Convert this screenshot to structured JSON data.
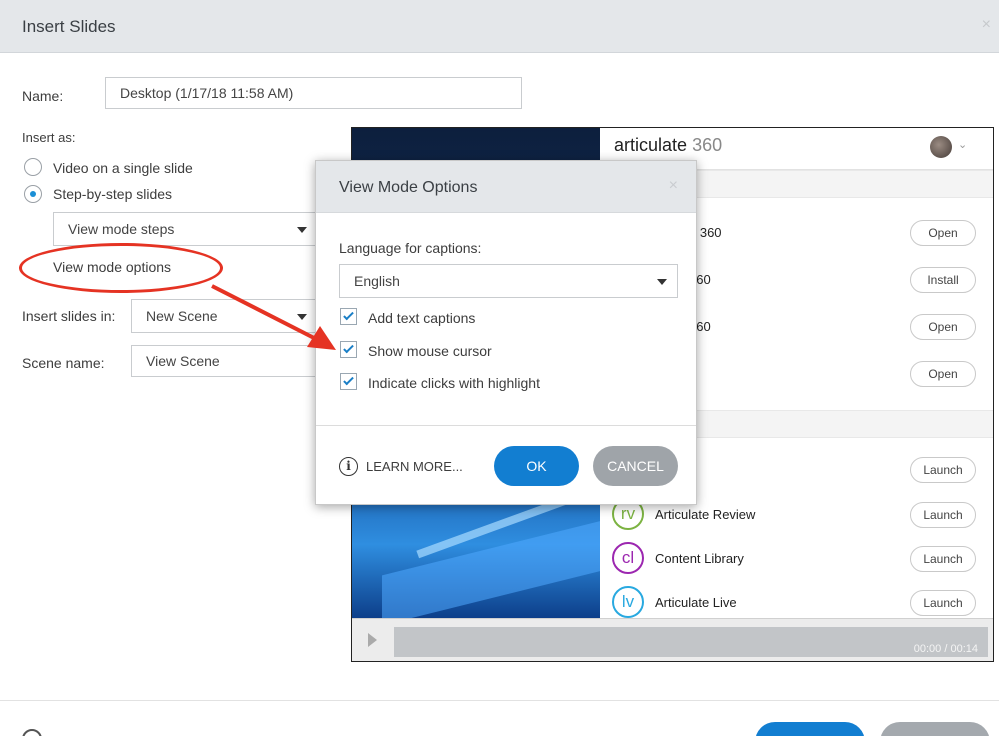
{
  "dialog": {
    "title": "Insert Slides",
    "close_icon": "×",
    "name_label": "Name:",
    "name_value": "Desktop (1/17/18 11:58 AM)",
    "insert_as_label": "Insert as:",
    "options": [
      {
        "label": "Video on a single slide",
        "selected": false
      },
      {
        "label": "Step-by-step slides",
        "selected": true
      }
    ],
    "mode_select": "View mode steps",
    "mode_options_link": "View mode options",
    "insert_in_label": "Insert slides in:",
    "insert_in_value": "New Scene",
    "scene_name_label": "Scene name:",
    "scene_name_value": "View Scene"
  },
  "preview": {
    "logo_text": "articulate",
    "logo_suffix": "360",
    "avatar_caret": "⌄",
    "rows": [
      {
        "text": "e 360",
        "button": "Open"
      },
      {
        "text": "360",
        "button": "Install"
      },
      {
        "text": "360",
        "button": "Open"
      },
      {
        "text": "",
        "button": "Open"
      }
    ],
    "apps": [
      {
        "icon": "",
        "name": "",
        "button": "Launch"
      },
      {
        "icon": "rv",
        "name": "Articulate Review",
        "button": "Launch",
        "color": "#7cb342"
      },
      {
        "icon": "cl",
        "name": "Content Library",
        "button": "Launch",
        "color": "#9c27b0"
      },
      {
        "icon": "lv",
        "name": "Articulate Live",
        "button": "Launch",
        "color": "#29a9e0"
      }
    ],
    "time": "00:00 / 00:14"
  },
  "modal": {
    "title": "View Mode Options",
    "close_icon": "×",
    "lang_label": "Language for captions:",
    "lang_value": "English",
    "checks": [
      {
        "label": "Add text captions",
        "checked": true
      },
      {
        "label": "Show mouse cursor",
        "checked": true
      },
      {
        "label": "Indicate clicks with highlight",
        "checked": true
      }
    ],
    "info_icon": "i",
    "learn_more": "LEARN MORE...",
    "ok": "OK",
    "cancel": "CANCEL"
  },
  "colors": {
    "accent": "#127ed1",
    "annotation": "#e53323"
  }
}
